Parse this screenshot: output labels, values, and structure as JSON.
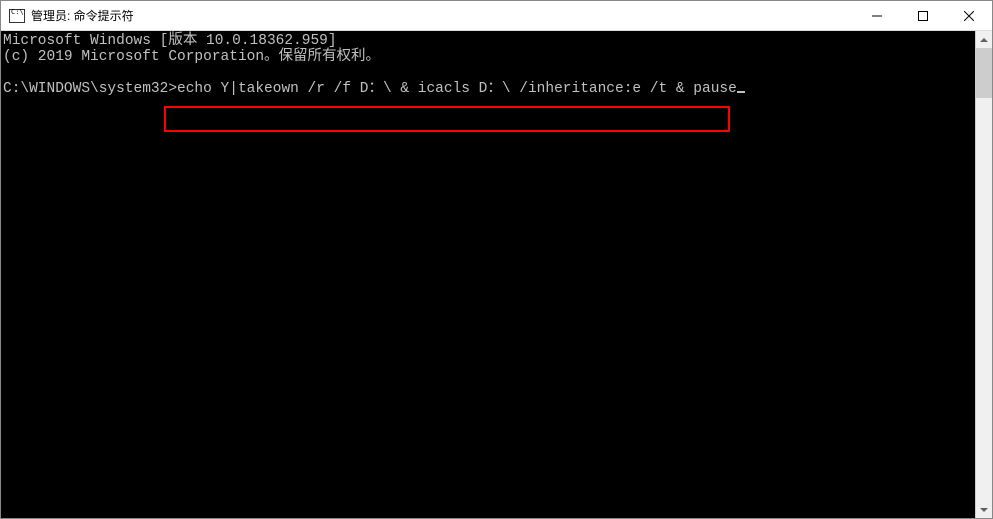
{
  "titlebar": {
    "title": "管理员: 命令提示符"
  },
  "terminal": {
    "line1": "Microsoft Windows [版本 10.0.18362.959]",
    "line2": "(c) 2019 Microsoft Corporation。保留所有权利。",
    "blank": "",
    "prompt": "C:\\WINDOWS\\system32>",
    "command": "echo Y|takeown /r /f D：\\ & icacls D：\\ /inheritance:e /t & pause"
  }
}
